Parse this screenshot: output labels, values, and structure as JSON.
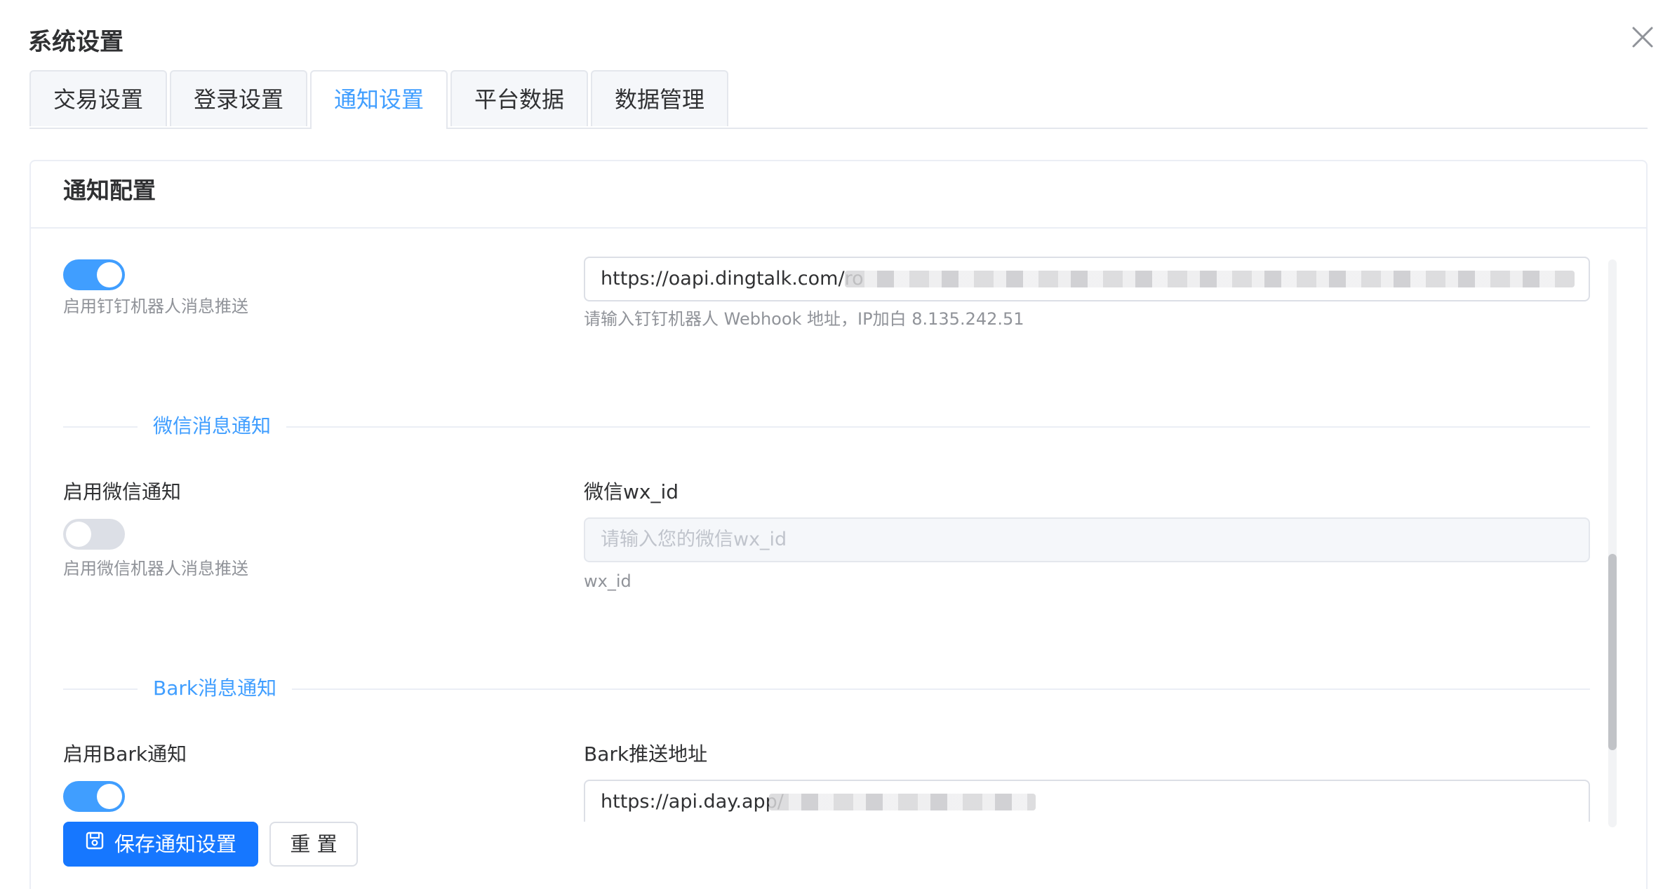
{
  "dialog": {
    "title": "系统设置"
  },
  "tabs": [
    {
      "label": "交易设置"
    },
    {
      "label": "登录设置"
    },
    {
      "label": "通知设置",
      "active": true
    },
    {
      "label": "平台数据"
    },
    {
      "label": "数据管理"
    }
  ],
  "card": {
    "title": "通知配置"
  },
  "dingtalk": {
    "enabled": true,
    "switch_help": "启用钉钉机器人消息推送",
    "webhook_value": "https://oapi.dingtalk.com/ro",
    "webhook_help": "请输入钉钉机器人 Webhook 地址，IP加白 8.135.242.51"
  },
  "wechat": {
    "section_title": "微信消息通知",
    "enable_label": "启用微信通知",
    "enabled": false,
    "switch_help": "启用微信机器人消息推送",
    "id_label": "微信wx_id",
    "id_placeholder": "请输入您的微信wx_id",
    "id_help": "wx_id"
  },
  "bark": {
    "section_title": "Bark消息通知",
    "enable_label": "启用Bark通知",
    "enabled": true,
    "url_label": "Bark推送地址",
    "url_value": "https://api.day.app/"
  },
  "actions": {
    "save_label": "保存通知设置",
    "reset_label": "重 置"
  },
  "colors": {
    "accent": "#409eff",
    "primary_button": "#1677ff",
    "switch_off": "#dcdfe6"
  }
}
